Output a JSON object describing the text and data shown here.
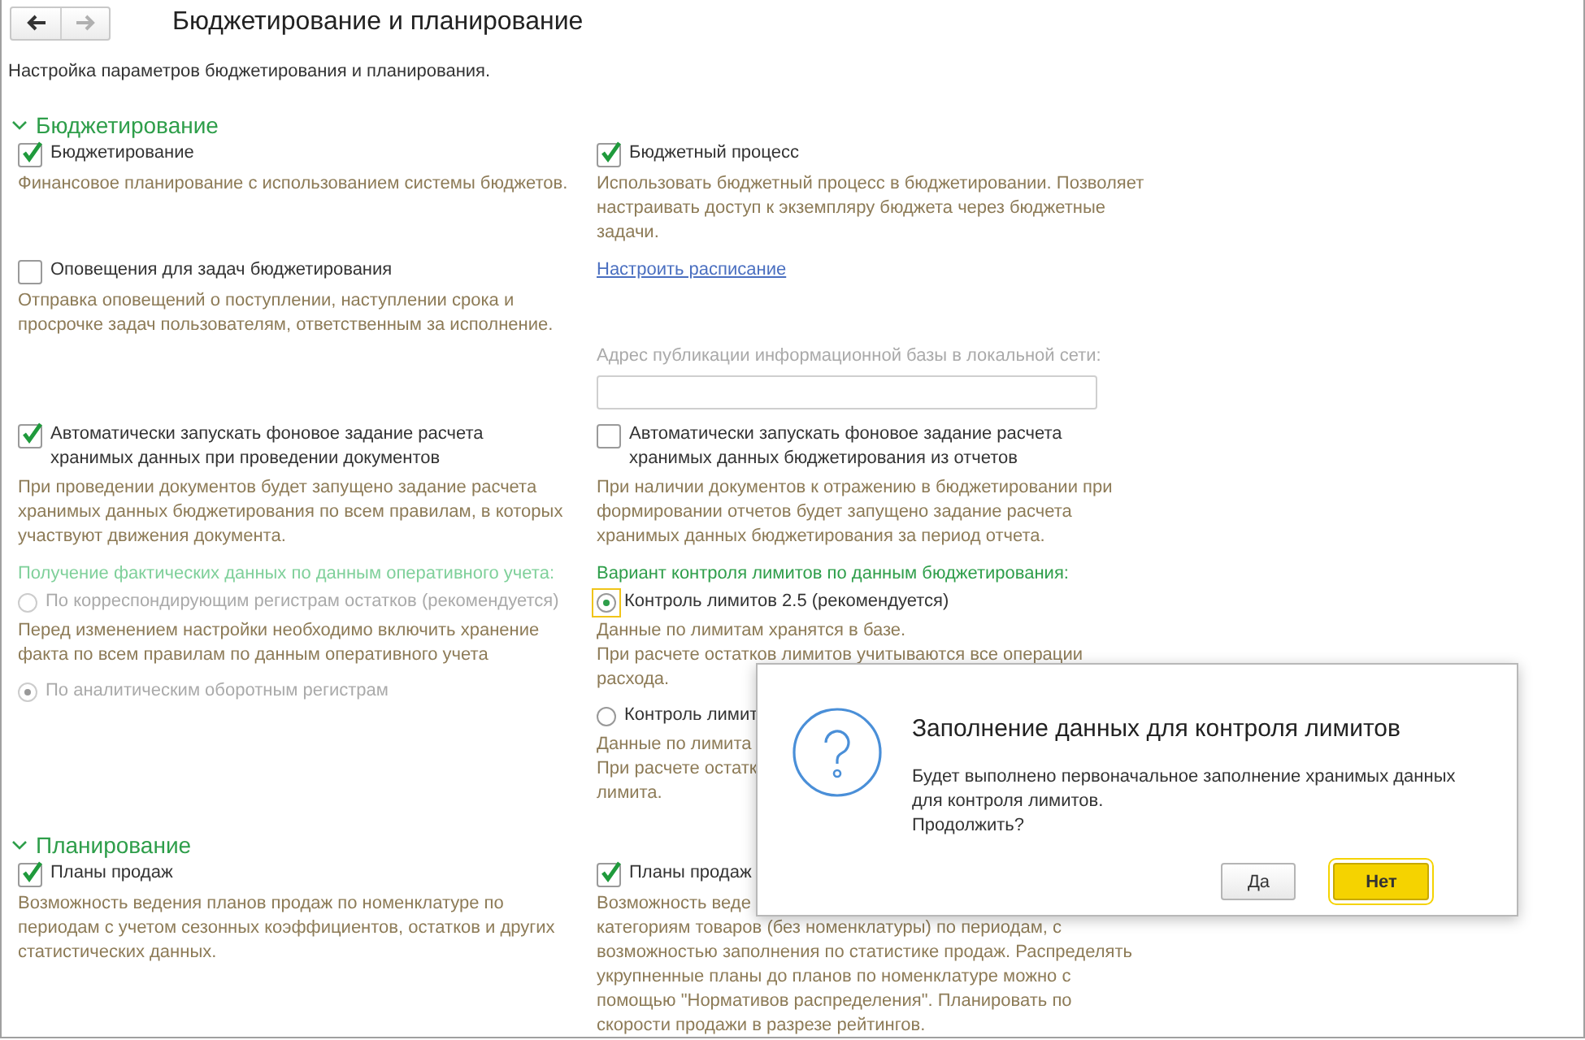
{
  "window": {
    "title": "Бюджетирование и планирование",
    "nav": [
      {
        "kind": "back",
        "disabled": false
      },
      {
        "kind": "forward",
        "disabled": true
      }
    ]
  },
  "description": "Настройка параметров бюджетирования и планирования.",
  "sections": [
    {
      "title": "Бюджетирование",
      "expanded": true,
      "rows": [
        {
          "left": [
            {
              "kind": "checkbox",
              "label": "Бюджетирование",
              "checked": true
            },
            {
              "kind": "description",
              "text": "Финансовое планирование с использованием системы бюджетов."
            }
          ],
          "right": [
            {
              "kind": "checkbox",
              "label": "Бюджетный процесс",
              "checked": true
            },
            {
              "kind": "description",
              "text": "Использовать бюджетный процесс в бюджетировании. Позволяет\nнастраивать доступ к экземпляру бюджета через бюджетные\nзадачи."
            }
          ]
        },
        {
          "left": [
            {
              "kind": "checkbox",
              "label": "Оповещения для задач бюджетирования",
              "checked": false
            },
            {
              "kind": "description",
              "text": "Отправка оповещений о поступлении, наступлении срока и\nпросрочке задач пользователям, ответственным за исполнение."
            }
          ],
          "right": [
            {
              "kind": "link",
              "text": "Настроить расписание"
            },
            {
              "kind": "field",
              "label": "Адрес публикации информационной базы в локальной сети:",
              "disabled": true
            }
          ]
        },
        {
          "left": [
            {
              "kind": "checkbox",
              "label": "Автоматически запускать фоновое задание расчета\nхранимых данных при проведении документов",
              "checked": true
            },
            {
              "kind": "description",
              "text": "При проведении документов будет запущено задание расчета\nхранимых данных бюджетирования по всем правилам, в которых\nучаствуют движения документа."
            }
          ],
          "right": [
            {
              "kind": "checkbox",
              "label": "Автоматически запускать фоновое задание расчета\nхранимых данных бюджетирования из отчетов",
              "checked": false
            },
            {
              "kind": "description",
              "text": "При наличии документов к отражению в бюджетировании при\nформировании отчетов будет запущено задание расчета\nхранимых данных бюджетирования за период отчета."
            }
          ]
        },
        {
          "left": [
            {
              "kind": "group_label",
              "text": "Получение фактических данных по данным оперативного учета:",
              "disabled": true
            },
            {
              "kind": "radio",
              "label": "По корреспондирующим регистрам остатков (рекомендуется)",
              "selected": false,
              "disabled": true,
              "focused": false
            },
            {
              "kind": "description",
              "text": "Перед изменением настройки необходимо включить хранение\nфакта по всем правилам по данным оперативного учета"
            },
            {
              "kind": "radio",
              "label": "По аналитическим оборотным регистрам",
              "selected": true,
              "disabled": true,
              "focused": false
            }
          ],
          "right": [
            {
              "kind": "group_label",
              "text": "Вариант контроля лимитов по данным бюджетирования:",
              "disabled": false
            },
            {
              "kind": "radio",
              "label": "Контроль лимитов 2.5 (рекомендуется)",
              "selected": true,
              "disabled": false,
              "focused": true
            },
            {
              "kind": "description",
              "text": "Данные по лимитам хранятся в базе.\nПри расчете остатков лимитов учитываются все операции\nрасхода."
            },
            {
              "kind": "radio",
              "label": "Контроль лимит",
              "selected": false,
              "disabled": false,
              "focused": false
            },
            {
              "kind": "description",
              "text": "Данные по лимита\nПри расчете остатк\nлимита."
            }
          ]
        }
      ]
    },
    {
      "title": "Планирование",
      "expanded": true,
      "rows": [
        {
          "left": [
            {
              "kind": "checkbox",
              "label": "Планы продаж",
              "checked": true
            },
            {
              "kind": "description",
              "text": "Возможность ведения планов продаж по номенклатуре по\nпериодам с учетом сезонных коэффициентов, остатков и других\nстатистических данных."
            }
          ],
          "right": [
            {
              "kind": "checkbox",
              "label": "Планы продаж",
              "checked": true
            },
            {
              "kind": "description",
              "text": "Возможность веде\nкатегориям товаров (без номенклатуры) по периодам, с\nвозможностью заполнения по статистике продаж. Распределять\nукрупненные планы до планов по номенклатуре можно с\nпомощью \"Нормативов распределения\". Планировать по\nскорости продажи в разрезе рейтингов."
            }
          ]
        }
      ]
    }
  ],
  "dialog": {
    "title": "Заполнение данных для контроля лимитов",
    "message": "Будет выполнено первоначальное заполнение хранимых данных\nдля контроля лимитов.\nПродолжить?",
    "buttons": [
      {
        "label": "Да",
        "default": false
      },
      {
        "label": "Нет",
        "default": true
      }
    ]
  }
}
